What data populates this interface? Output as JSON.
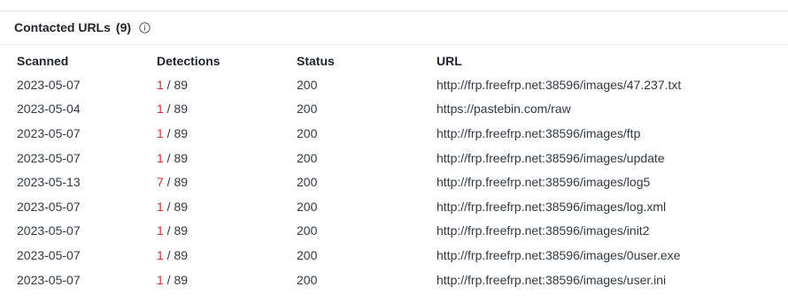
{
  "section": {
    "title": "Contacted URLs",
    "count": "(9)",
    "info_icon": "info-circle-icon"
  },
  "table": {
    "headers": {
      "scanned": "Scanned",
      "detections": "Detections",
      "status": "Status",
      "url": "URL"
    },
    "rows": [
      {
        "scanned": "2023-05-07",
        "detections_positive": "1",
        "detections_total": " / 89",
        "status": "200",
        "url": "http://frp.freefrp.net:38596/images/47.237.txt"
      },
      {
        "scanned": "2023-05-04",
        "detections_positive": "1",
        "detections_total": " / 89",
        "status": "200",
        "url": "https://pastebin.com/raw"
      },
      {
        "scanned": "2023-05-07",
        "detections_positive": "1",
        "detections_total": " / 89",
        "status": "200",
        "url": "http://frp.freefrp.net:38596/images/ftp"
      },
      {
        "scanned": "2023-05-07",
        "detections_positive": "1",
        "detections_total": " / 89",
        "status": "200",
        "url": "http://frp.freefrp.net:38596/images/update"
      },
      {
        "scanned": "2023-05-13",
        "detections_positive": "7",
        "detections_total": " / 89",
        "status": "200",
        "url": "http://frp.freefrp.net:38596/images/log5"
      },
      {
        "scanned": "2023-05-07",
        "detections_positive": "1",
        "detections_total": " / 89",
        "status": "200",
        "url": "http://frp.freefrp.net:38596/images/log.xml"
      },
      {
        "scanned": "2023-05-07",
        "detections_positive": "1",
        "detections_total": " / 89",
        "status": "200",
        "url": "http://frp.freefrp.net:38596/images/init2"
      },
      {
        "scanned": "2023-05-07",
        "detections_positive": "1",
        "detections_total": " / 89",
        "status": "200",
        "url": "http://frp.freefrp.net:38596/images/0user.exe"
      },
      {
        "scanned": "2023-05-07",
        "detections_positive": "1",
        "detections_total": " / 89",
        "status": "200",
        "url": "http://frp.freefrp.net:38596/images/user.ini"
      }
    ]
  },
  "colors": {
    "detection_positive": "#d0312d",
    "text": "#333940",
    "divider": "#e6e7ea"
  }
}
